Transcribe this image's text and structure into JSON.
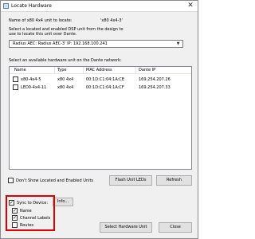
{
  "window": {
    "title": "Locate Hardware"
  },
  "header": {
    "unit_label": "Name of x80 4x4 unit to locate:",
    "unit_name": "'x80 4x4-3'",
    "instruction": "Select a located and enabled DSP unit from the design to use to locate this unit over Dante.",
    "combo_value": "Radius AEC: Radius AEC-3' IP: 192.168.100.241"
  },
  "list": {
    "caption": "Select an available hardware unit on the Dante network:",
    "columns": [
      "Name",
      "Type",
      "MAC Address",
      "Dante IP"
    ],
    "rows": [
      {
        "name": "x80-4x4-5",
        "type": "x80 4x4",
        "mac": "00:1D:C1:04:1A:CE",
        "ip": "169.254.207.26"
      },
      {
        "name": "LED0-4x4-11",
        "type": "x80 4x4",
        "mac": "00:1D:C1:04:1A:CF",
        "ip": "169.254.207.33"
      }
    ]
  },
  "options": {
    "dont_show_label": "Don't Show Located and Enabled Units",
    "flash_label": "Flash Unit LEDs",
    "refresh_label": "Refresh"
  },
  "sync": {
    "sync_label": "Sync to Device:",
    "info_label": "Info...",
    "items": [
      {
        "label": "Name",
        "checked": true
      },
      {
        "label": "Channel Labels",
        "checked": true
      },
      {
        "label": "Routes",
        "checked": false
      }
    ]
  },
  "footer": {
    "select_label": "Select Hardware Unit",
    "close_label": "Close"
  }
}
